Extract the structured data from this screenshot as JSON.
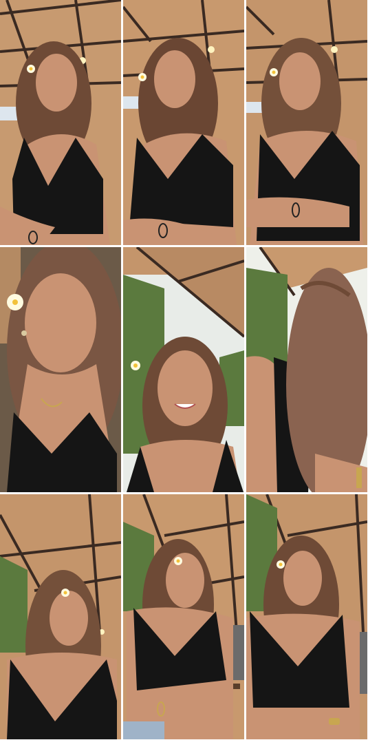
{
  "grid": {
    "rows": 3,
    "columns": 3,
    "tiles": [
      {
        "scene": "ceiling",
        "pose": "looking-up",
        "hair": "#6e4a36"
      },
      {
        "scene": "ceiling",
        "pose": "tilted",
        "hair": "#6a4633"
      },
      {
        "scene": "ceiling",
        "pose": "smiling",
        "hair": "#74503a"
      },
      {
        "scene": "close-up",
        "pose": "looking-down",
        "hair": "#7a5643"
      },
      {
        "scene": "trees",
        "pose": "laughing",
        "hair": "#6e4a36"
      },
      {
        "scene": "trees",
        "pose": "back-of-hair",
        "hair": "#8a6350"
      },
      {
        "scene": "ceiling",
        "pose": "profile-up",
        "hair": "#74503a"
      },
      {
        "scene": "cafe",
        "pose": "seated",
        "hair": "#6e4a36"
      },
      {
        "scene": "cafe",
        "pose": "seated-closed-eyes",
        "hair": "#6e4a36"
      }
    ]
  },
  "colors": {
    "ceiling": "#b88a63",
    "beam": "#3a2a22",
    "skin": "#c99373",
    "dress": "#151515",
    "foliage": "#5b7a3e",
    "sky": "#e8ece8"
  }
}
